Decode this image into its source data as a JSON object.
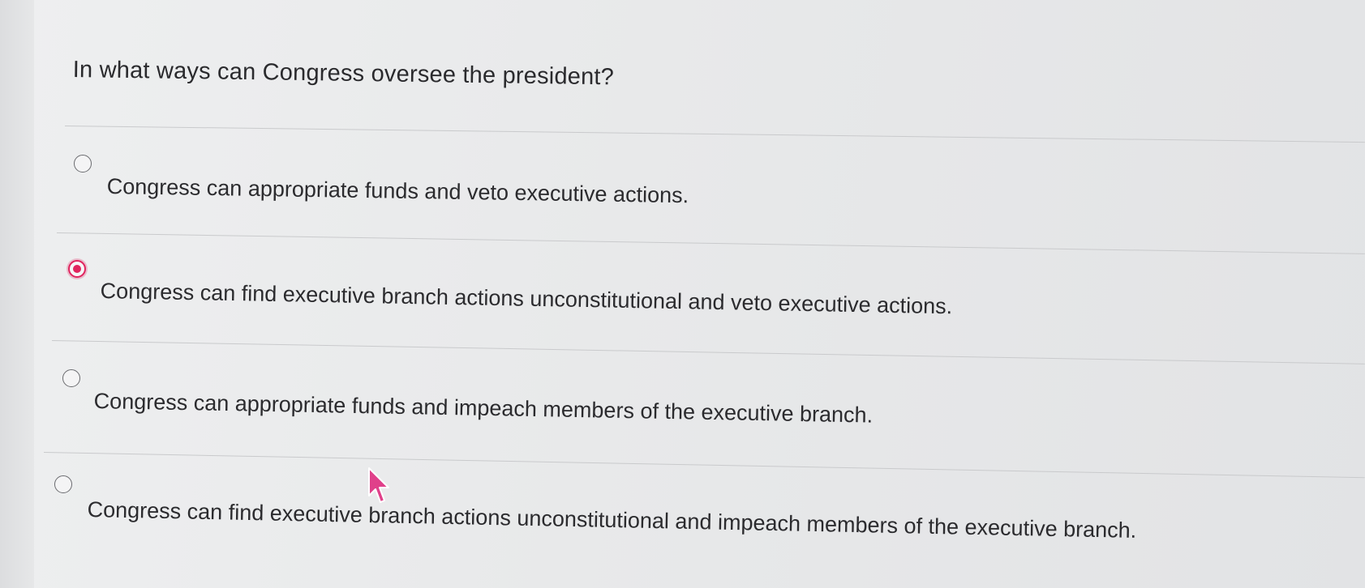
{
  "question": {
    "text": "In what ways can Congress oversee the president?"
  },
  "options": [
    {
      "label": "Congress can appropriate funds and veto executive actions.",
      "selected": false
    },
    {
      "label": "Congress can find executive branch actions unconstitutional and veto executive actions.",
      "selected": true
    },
    {
      "label": "Congress can appropriate funds and impeach members of the executive branch.",
      "selected": false
    },
    {
      "label": "Congress can find executive branch actions unconstitutional and impeach members of the executive branch.",
      "selected": false
    }
  ],
  "colors": {
    "selected_accent": "#e0245e",
    "cursor": "#e0408a"
  },
  "icons": {
    "cursor": "mouse-pointer-icon"
  }
}
